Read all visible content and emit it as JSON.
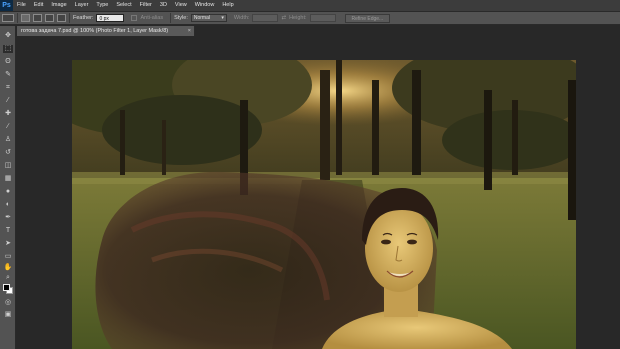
{
  "app": {
    "logo": "Ps"
  },
  "menu": [
    "File",
    "Edit",
    "Image",
    "Layer",
    "Type",
    "Select",
    "Filter",
    "3D",
    "View",
    "Window",
    "Help"
  ],
  "options": {
    "feather_label": "Feather:",
    "feather_value": "0 px",
    "antialias_label": "Anti-alias",
    "style_label": "Style:",
    "style_value": "Normal",
    "width_label": "Width:",
    "height_label": "Height:",
    "refine_edge_label": "Refine Edge..."
  },
  "document": {
    "tab_title": "готова задача 7.psd @ 100% (Photo Filter 1, Layer Mask/8)",
    "close_glyph": "×"
  },
  "tools": [
    "move-tool",
    "marquee-tool",
    "lasso-tool",
    "quick-select-tool",
    "crop-tool",
    "eyedropper-tool",
    "healing-tool",
    "brush-tool",
    "clone-stamp-tool",
    "history-brush-tool",
    "eraser-tool",
    "gradient-tool",
    "blur-tool",
    "dodge-tool",
    "pen-tool",
    "type-tool",
    "path-select-tool",
    "shape-tool",
    "hand-tool",
    "zoom-tool"
  ],
  "colors": {
    "foreground": "#000000",
    "background": "#ffffff",
    "ui_panel": "#535353",
    "workspace": "#282828"
  }
}
